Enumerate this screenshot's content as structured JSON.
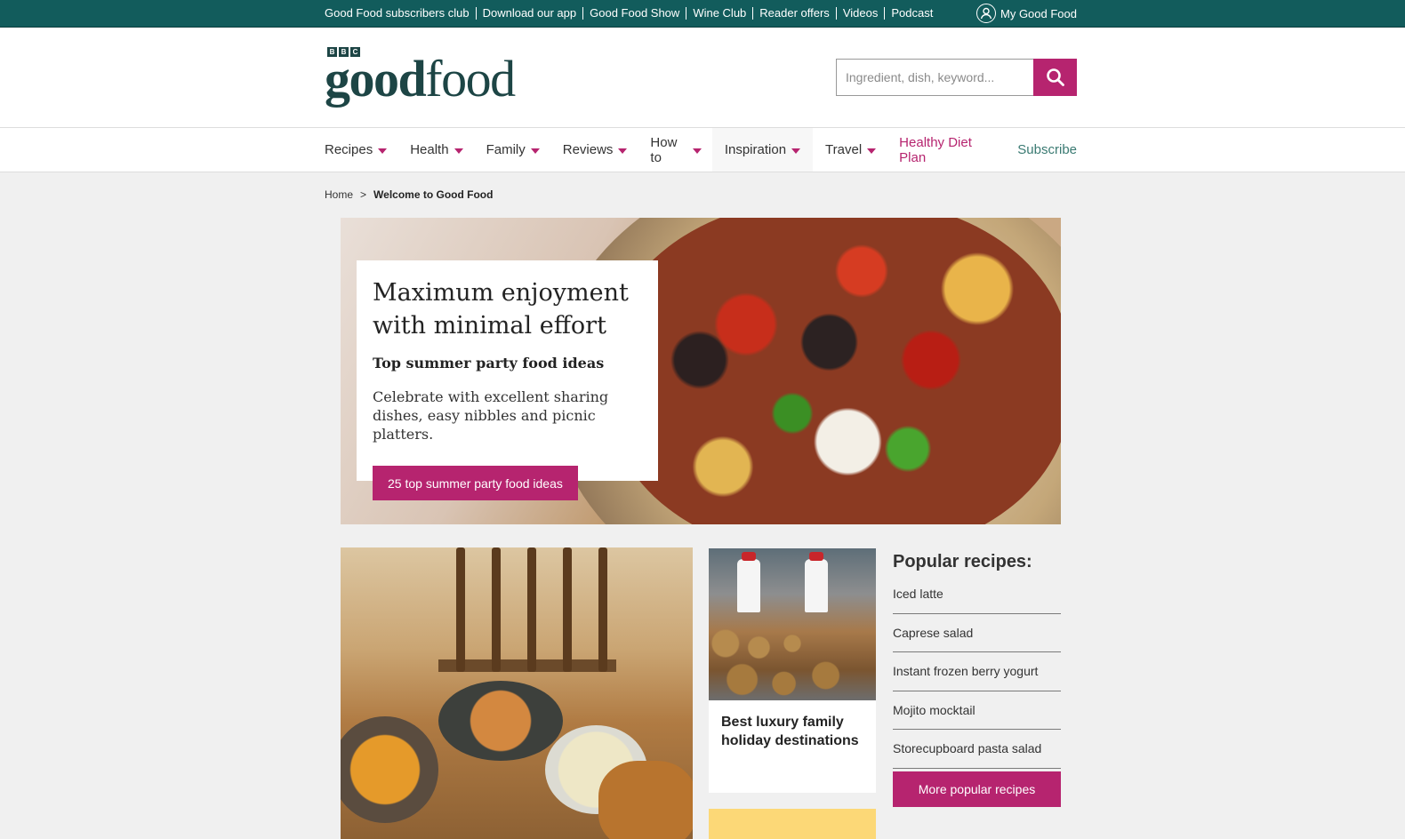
{
  "topbar": {
    "links": [
      "Good Food subscribers club",
      "Download our app",
      "Good Food Show",
      "Wine Club",
      "Reader offers",
      "Videos",
      "Podcast"
    ],
    "account_label": "My Good Food"
  },
  "header": {
    "logo_bbc": [
      "B",
      "B",
      "C"
    ],
    "logo_word_bold": "good",
    "logo_word_light": "food",
    "search_placeholder": "Ingredient, dish, keyword..."
  },
  "nav": {
    "items": [
      "Recipes",
      "Health",
      "Family",
      "Reviews",
      "How to",
      "Inspiration",
      "Travel"
    ],
    "healthy_diet": "Healthy Diet Plan",
    "subscribe": "Subscribe"
  },
  "breadcrumb": {
    "home": "Home",
    "separator": ">",
    "current": "Welcome to Good Food"
  },
  "hero": {
    "title": "Maximum enjoyment with minimal effort",
    "subtitle": "Top summer party food ideas",
    "description": "Celebrate with excellent sharing dishes, easy nibbles and picnic platters.",
    "button": "25 top summer party food ideas"
  },
  "cards": {
    "holiday_title": "Best luxury family holiday destinations"
  },
  "popular": {
    "heading": "Popular recipes:",
    "items": [
      "Iced latte",
      "Caprese salad",
      "Instant frozen berry yogurt",
      "Mojito mocktail",
      "Storecupboard pasta salad"
    ],
    "button": "More popular recipes"
  },
  "colors": {
    "topbar": "#125c5c",
    "brand_pink": "#b6246f",
    "logo_green": "#1d4545"
  }
}
